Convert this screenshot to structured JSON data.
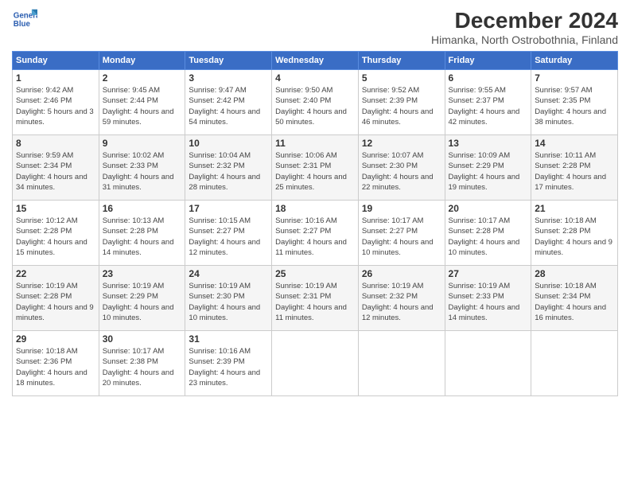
{
  "logo": {
    "line1": "General",
    "line2": "Blue"
  },
  "title": "December 2024",
  "subtitle": "Himanka, North Ostrobothnia, Finland",
  "headers": [
    "Sunday",
    "Monday",
    "Tuesday",
    "Wednesday",
    "Thursday",
    "Friday",
    "Saturday"
  ],
  "weeks": [
    [
      {
        "day": "1",
        "sunrise": "Sunrise: 9:42 AM",
        "sunset": "Sunset: 2:46 PM",
        "daylight": "Daylight: 5 hours and 3 minutes."
      },
      {
        "day": "2",
        "sunrise": "Sunrise: 9:45 AM",
        "sunset": "Sunset: 2:44 PM",
        "daylight": "Daylight: 4 hours and 59 minutes."
      },
      {
        "day": "3",
        "sunrise": "Sunrise: 9:47 AM",
        "sunset": "Sunset: 2:42 PM",
        "daylight": "Daylight: 4 hours and 54 minutes."
      },
      {
        "day": "4",
        "sunrise": "Sunrise: 9:50 AM",
        "sunset": "Sunset: 2:40 PM",
        "daylight": "Daylight: 4 hours and 50 minutes."
      },
      {
        "day": "5",
        "sunrise": "Sunrise: 9:52 AM",
        "sunset": "Sunset: 2:39 PM",
        "daylight": "Daylight: 4 hours and 46 minutes."
      },
      {
        "day": "6",
        "sunrise": "Sunrise: 9:55 AM",
        "sunset": "Sunset: 2:37 PM",
        "daylight": "Daylight: 4 hours and 42 minutes."
      },
      {
        "day": "7",
        "sunrise": "Sunrise: 9:57 AM",
        "sunset": "Sunset: 2:35 PM",
        "daylight": "Daylight: 4 hours and 38 minutes."
      }
    ],
    [
      {
        "day": "8",
        "sunrise": "Sunrise: 9:59 AM",
        "sunset": "Sunset: 2:34 PM",
        "daylight": "Daylight: 4 hours and 34 minutes."
      },
      {
        "day": "9",
        "sunrise": "Sunrise: 10:02 AM",
        "sunset": "Sunset: 2:33 PM",
        "daylight": "Daylight: 4 hours and 31 minutes."
      },
      {
        "day": "10",
        "sunrise": "Sunrise: 10:04 AM",
        "sunset": "Sunset: 2:32 PM",
        "daylight": "Daylight: 4 hours and 28 minutes."
      },
      {
        "day": "11",
        "sunrise": "Sunrise: 10:06 AM",
        "sunset": "Sunset: 2:31 PM",
        "daylight": "Daylight: 4 hours and 25 minutes."
      },
      {
        "day": "12",
        "sunrise": "Sunrise: 10:07 AM",
        "sunset": "Sunset: 2:30 PM",
        "daylight": "Daylight: 4 hours and 22 minutes."
      },
      {
        "day": "13",
        "sunrise": "Sunrise: 10:09 AM",
        "sunset": "Sunset: 2:29 PM",
        "daylight": "Daylight: 4 hours and 19 minutes."
      },
      {
        "day": "14",
        "sunrise": "Sunrise: 10:11 AM",
        "sunset": "Sunset: 2:28 PM",
        "daylight": "Daylight: 4 hours and 17 minutes."
      }
    ],
    [
      {
        "day": "15",
        "sunrise": "Sunrise: 10:12 AM",
        "sunset": "Sunset: 2:28 PM",
        "daylight": "Daylight: 4 hours and 15 minutes."
      },
      {
        "day": "16",
        "sunrise": "Sunrise: 10:13 AM",
        "sunset": "Sunset: 2:28 PM",
        "daylight": "Daylight: 4 hours and 14 minutes."
      },
      {
        "day": "17",
        "sunrise": "Sunrise: 10:15 AM",
        "sunset": "Sunset: 2:27 PM",
        "daylight": "Daylight: 4 hours and 12 minutes."
      },
      {
        "day": "18",
        "sunrise": "Sunrise: 10:16 AM",
        "sunset": "Sunset: 2:27 PM",
        "daylight": "Daylight: 4 hours and 11 minutes."
      },
      {
        "day": "19",
        "sunrise": "Sunrise: 10:17 AM",
        "sunset": "Sunset: 2:27 PM",
        "daylight": "Daylight: 4 hours and 10 minutes."
      },
      {
        "day": "20",
        "sunrise": "Sunrise: 10:17 AM",
        "sunset": "Sunset: 2:28 PM",
        "daylight": "Daylight: 4 hours and 10 minutes."
      },
      {
        "day": "21",
        "sunrise": "Sunrise: 10:18 AM",
        "sunset": "Sunset: 2:28 PM",
        "daylight": "Daylight: 4 hours and 9 minutes."
      }
    ],
    [
      {
        "day": "22",
        "sunrise": "Sunrise: 10:19 AM",
        "sunset": "Sunset: 2:28 PM",
        "daylight": "Daylight: 4 hours and 9 minutes."
      },
      {
        "day": "23",
        "sunrise": "Sunrise: 10:19 AM",
        "sunset": "Sunset: 2:29 PM",
        "daylight": "Daylight: 4 hours and 10 minutes."
      },
      {
        "day": "24",
        "sunrise": "Sunrise: 10:19 AM",
        "sunset": "Sunset: 2:30 PM",
        "daylight": "Daylight: 4 hours and 10 minutes."
      },
      {
        "day": "25",
        "sunrise": "Sunrise: 10:19 AM",
        "sunset": "Sunset: 2:31 PM",
        "daylight": "Daylight: 4 hours and 11 minutes."
      },
      {
        "day": "26",
        "sunrise": "Sunrise: 10:19 AM",
        "sunset": "Sunset: 2:32 PM",
        "daylight": "Daylight: 4 hours and 12 minutes."
      },
      {
        "day": "27",
        "sunrise": "Sunrise: 10:19 AM",
        "sunset": "Sunset: 2:33 PM",
        "daylight": "Daylight: 4 hours and 14 minutes."
      },
      {
        "day": "28",
        "sunrise": "Sunrise: 10:18 AM",
        "sunset": "Sunset: 2:34 PM",
        "daylight": "Daylight: 4 hours and 16 minutes."
      }
    ],
    [
      {
        "day": "29",
        "sunrise": "Sunrise: 10:18 AM",
        "sunset": "Sunset: 2:36 PM",
        "daylight": "Daylight: 4 hours and 18 minutes."
      },
      {
        "day": "30",
        "sunrise": "Sunrise: 10:17 AM",
        "sunset": "Sunset: 2:38 PM",
        "daylight": "Daylight: 4 hours and 20 minutes."
      },
      {
        "day": "31",
        "sunrise": "Sunrise: 10:16 AM",
        "sunset": "Sunset: 2:39 PM",
        "daylight": "Daylight: 4 hours and 23 minutes."
      },
      null,
      null,
      null,
      null
    ]
  ]
}
